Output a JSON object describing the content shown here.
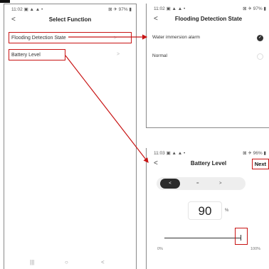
{
  "colors": {
    "highlight": "#c81414",
    "accent_dark": "#2b2b2b"
  },
  "screen1": {
    "status_time": "11:02",
    "status_icons": "▣ ▲ ▲ •",
    "status_right": "⊠ ✈ 97% ▮",
    "back_icon": "chevron-left-icon",
    "back_glyph": "<",
    "title": "Select Function",
    "items": [
      {
        "label": "Flooding Detection State",
        "chevron": ">"
      },
      {
        "label": "Battery Level",
        "chevron": ">"
      }
    ],
    "navbar": {
      "recent": "|||",
      "home": "○",
      "back": "<"
    }
  },
  "screen2": {
    "status_time": "11:02",
    "status_icons": "▣ ▲ ▲ •",
    "status_right": "⊠ ✈ 97% ▮",
    "back_glyph": "<",
    "title": "Flooding Detection State",
    "options": [
      {
        "label": "Water immersion alarm",
        "selected": true,
        "check": "✓"
      },
      {
        "label": "Normal",
        "selected": false
      }
    ]
  },
  "screen3": {
    "status_time": "11:03",
    "status_icons": "▣ ▲ ▲ •",
    "status_right": "⊠ ✈ 96% ▮",
    "back_glyph": "<",
    "title": "Battery Level",
    "next_label": "Next",
    "segment": {
      "left": "<",
      "middle": "=",
      "right": ">"
    },
    "value": "90",
    "unit": "%",
    "slider": {
      "min_label": "0%",
      "max_label": "100%",
      "value": 90
    }
  }
}
